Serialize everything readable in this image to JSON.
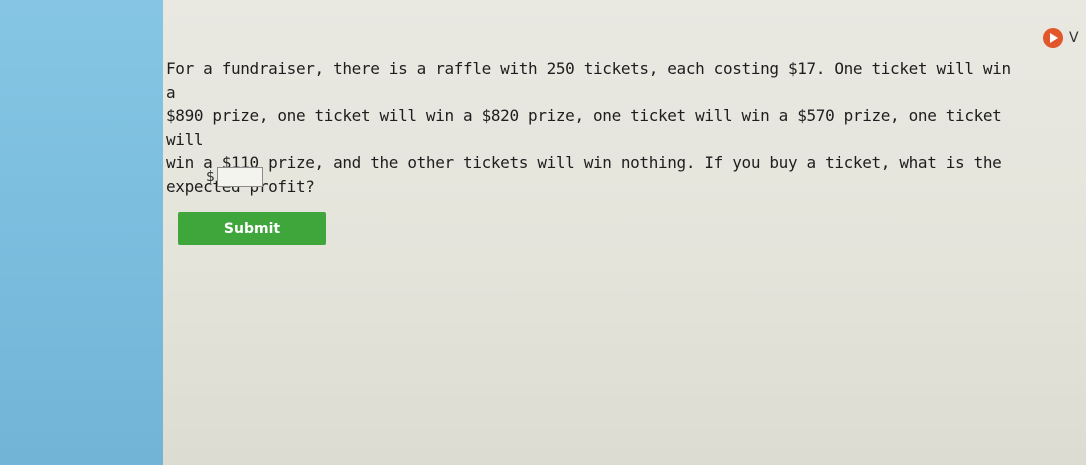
{
  "question": {
    "line1": "For a fundraiser, there is a raffle with 250 tickets, each costing $17. One ticket will win a",
    "line2": "$890 prize, one ticket will win a $820 prize, one ticket will win a $570 prize, one ticket will",
    "line3": "win a $110 prize, and the other tickets will win nothing. If you buy a ticket, what is the",
    "line4": "expected profit?"
  },
  "answer": {
    "currency_symbol": "$",
    "value": ""
  },
  "submit_label": "Submit",
  "video": {
    "label": "V",
    "icon": "play-icon"
  },
  "colors": {
    "left_strip": "#7dbfdf",
    "submit_button": "#3ea63a",
    "video_badge": "#e2562b"
  }
}
